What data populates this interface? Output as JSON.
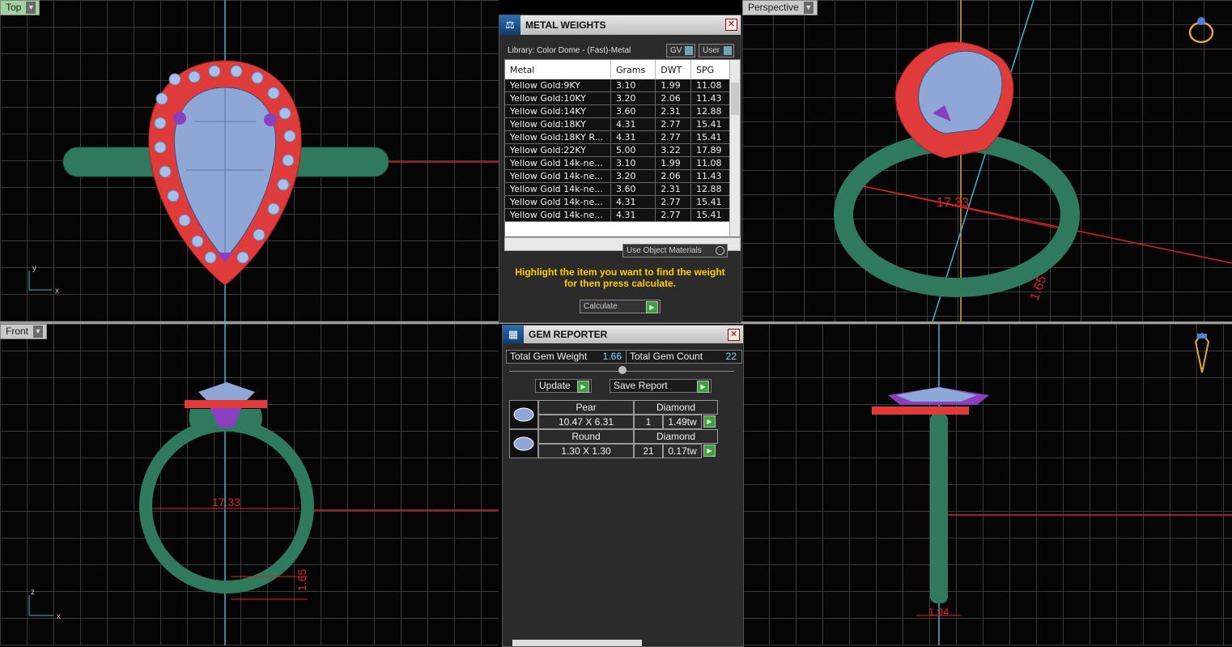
{
  "viewports": {
    "top": {
      "label": "Top",
      "axis_y": "y",
      "axis_x": "x"
    },
    "perspective": {
      "label": "Perspective",
      "dimension": "17.33",
      "dimension2": "1.65"
    },
    "front": {
      "label": "Front",
      "axis_z": "z",
      "axis_x": "x",
      "dimension": "17.33",
      "dimension2": "1.65"
    },
    "right": {
      "dimension": "1.94"
    }
  },
  "metal_weights": {
    "title": "METAL WEIGHTS",
    "library": "Library: Color Dome - (Fast)-Metal",
    "gv_label": "GV",
    "user_label": "User",
    "columns": [
      "Metal",
      "Grams",
      "DWT",
      "SPG"
    ],
    "rows": [
      [
        "Yellow Gold:9KY",
        "3.10",
        "1.99",
        "11.08"
      ],
      [
        "Yellow Gold:10KY",
        "3.20",
        "2.06",
        "11.43"
      ],
      [
        "Yellow Gold:14KY",
        "3.60",
        "2.31",
        "12.88"
      ],
      [
        "Yellow Gold:18KY",
        "4.31",
        "2.77",
        "15.41"
      ],
      [
        "Yellow Gold:18KY R...",
        "4.31",
        "2.77",
        "15.41"
      ],
      [
        "Yellow Gold:22KY",
        "5.00",
        "3.22",
        "17.89"
      ],
      [
        "Yellow Gold 14k-ne...",
        "3.10",
        "1.99",
        "11.08"
      ],
      [
        "Yellow Gold 14k-ne...",
        "3.20",
        "2.06",
        "11.43"
      ],
      [
        "Yellow Gold 14k-ne...",
        "3.60",
        "2.31",
        "12.88"
      ],
      [
        "Yellow Gold 14k-ne...",
        "4.31",
        "2.77",
        "15.41"
      ],
      [
        "Yellow Gold 14k-ne...",
        "4.31",
        "2.77",
        "15.41"
      ]
    ],
    "use_object_materials": "Use Object Materials",
    "hint": "Highlight the item you want to find the weight for then press calculate.",
    "calculate_label": "Calculate",
    "hint_color": "#ffcc00"
  },
  "gem_reporter": {
    "title": "GEM REPORTER",
    "total_weight_label": "Total Gem Weight",
    "total_weight_value": "1.66",
    "total_count_label": "Total Gem Count",
    "total_count_value": "22",
    "update_label": "Update",
    "save_report_label": "Save Report",
    "gems": [
      {
        "shape": "Pear",
        "material": "Diamond",
        "size": "10.47 X 6.31",
        "count": "1",
        "weight": "1.49tw"
      },
      {
        "shape": "Round",
        "material": "Diamond",
        "size": "1.30 X 1.30",
        "count": "21",
        "weight": "0.17tw"
      }
    ]
  },
  "colors": {
    "band": "#2f7a5c",
    "halo": "#e03b3b",
    "gem": "#8fa7d6",
    "prong": "#8a3fc0",
    "axis_red": "#d22",
    "axis_cyan": "#3cb6d6"
  }
}
